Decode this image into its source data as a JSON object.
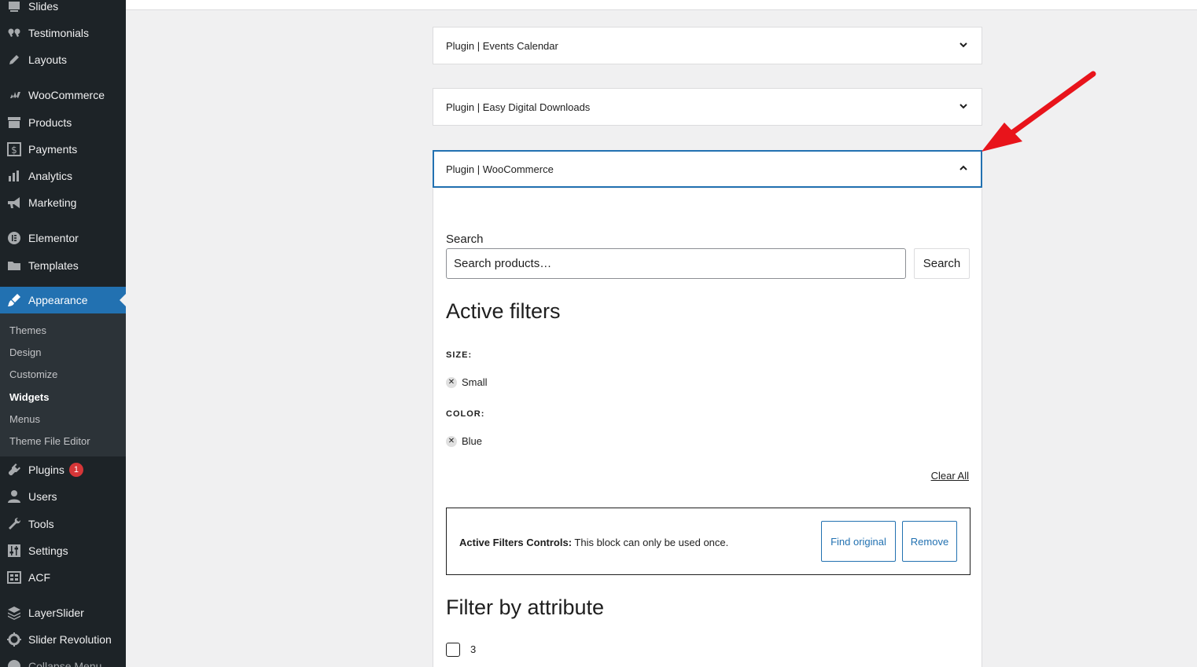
{
  "sidebar": {
    "items": [
      {
        "label": "Slides",
        "icon": "slides-icon"
      },
      {
        "label": "Testimonials",
        "icon": "quote-icon"
      },
      {
        "label": "Layouts",
        "icon": "pencil-icon"
      },
      {
        "label": "WooCommerce",
        "icon": "woocommerce-icon"
      },
      {
        "label": "Products",
        "icon": "archive-icon"
      },
      {
        "label": "Payments",
        "icon": "dollar-icon"
      },
      {
        "label": "Analytics",
        "icon": "bar-chart-icon"
      },
      {
        "label": "Marketing",
        "icon": "megaphone-icon"
      },
      {
        "label": "Elementor",
        "icon": "elementor-icon"
      },
      {
        "label": "Templates",
        "icon": "folder-icon"
      },
      {
        "label": "Appearance",
        "icon": "paintbrush-icon"
      },
      {
        "label": "Plugins",
        "icon": "plug-icon",
        "badge": "1"
      },
      {
        "label": "Users",
        "icon": "user-icon"
      },
      {
        "label": "Tools",
        "icon": "wrench-icon"
      },
      {
        "label": "Settings",
        "icon": "sliders-icon"
      },
      {
        "label": "ACF",
        "icon": "grid-icon"
      },
      {
        "label": "LayerSlider",
        "icon": "layers-icon"
      },
      {
        "label": "Slider Revolution",
        "icon": "revolution-icon"
      },
      {
        "label": "Collapse Menu",
        "icon": "collapse-icon"
      }
    ],
    "submenu": [
      "Themes",
      "Design",
      "Customize",
      "Widgets",
      "Menus",
      "Theme File Editor"
    ],
    "current_submenu": "Widgets"
  },
  "accordions": [
    {
      "title": "Plugin | Events Calendar",
      "open": false
    },
    {
      "title": "Plugin | Easy Digital Downloads",
      "open": false
    },
    {
      "title": "Plugin | WooCommerce",
      "open": true
    }
  ],
  "panel": {
    "search_label": "Search",
    "search_placeholder": "Search products…",
    "search_button": "Search",
    "active_filters_heading": "Active filters",
    "filters": [
      {
        "label": "SIZE:",
        "value": "Small"
      },
      {
        "label": "COLOR:",
        "value": "Blue"
      }
    ],
    "clear_all": "Clear All",
    "notice_bold": "Active Filters Controls:",
    "notice_text": " This block can only be used once.",
    "find_original": "Find original",
    "remove": "Remove",
    "filter_attr_heading": "Filter by attribute",
    "attr_option": "3"
  },
  "colors": {
    "sidebar_bg": "#1d2327",
    "accent": "#2271b1",
    "arrow": "#e8141b",
    "badge": "#d63638"
  }
}
